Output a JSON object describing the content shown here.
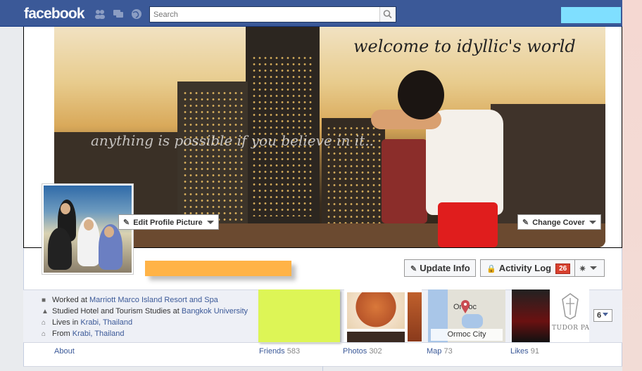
{
  "topbar": {
    "logo": "facebook",
    "search_placeholder": "Search",
    "jewels": [
      "friend-requests-icon",
      "messages-icon",
      "notifications-globe-icon"
    ]
  },
  "cover": {
    "welcome_text": "welcome to idyllic's world",
    "quote_text": "anything is possible if you believe in it..",
    "change_cover_label": "Change Cover",
    "edit_profile_picture_label": "Edit Profile Picture"
  },
  "actions": {
    "update_info_label": "Update Info",
    "activity_log_label": "Activity Log",
    "activity_log_count": "26"
  },
  "about": {
    "rows": [
      {
        "icon": "work-icon",
        "prefix": "Worked at ",
        "link": "Marriott Marco Island Resort and Spa"
      },
      {
        "icon": "education-icon",
        "prefix": "Studied Hotel and Tourism Studies at ",
        "link": "Bangkok University"
      },
      {
        "icon": "home-icon",
        "prefix": "Lives in ",
        "link": "Krabi, Thailand"
      },
      {
        "icon": "hometown-icon",
        "prefix": "From ",
        "link": "Krabi, Thailand"
      }
    ]
  },
  "tabs": {
    "about": {
      "label": "About"
    },
    "friends": {
      "label": "Friends",
      "count": "583"
    },
    "photos": {
      "label": "Photos",
      "count": "302"
    },
    "map": {
      "label": "Map",
      "count": "73",
      "tile_city": "Ormoc City",
      "tile_pin_label": "Ormoc"
    },
    "likes": {
      "label": "Likes",
      "count": "91",
      "tile_text": "TUDOR PARK"
    },
    "more_count": "6"
  },
  "colors": {
    "brand": "#3b5998",
    "badge": "#d8412f",
    "redact_cyan": "#7fdfff",
    "redact_orange": "#ffb347",
    "friends_tile": "#ddf556"
  }
}
